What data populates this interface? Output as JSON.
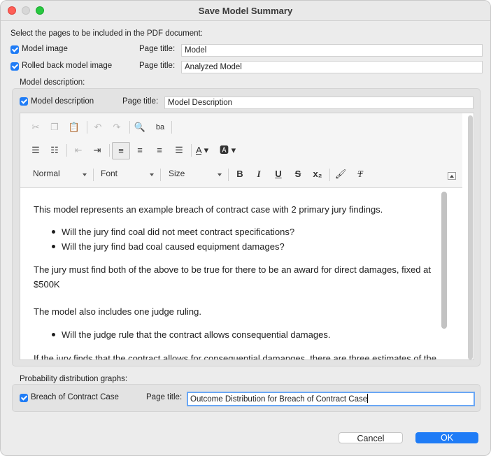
{
  "window": {
    "title": "Save Model Summary"
  },
  "intro_text": "Select the pages to be included in the PDF document:",
  "page_title_label": "Page title:",
  "pages": [
    {
      "checkbox_label": "Model image",
      "checked": true,
      "page_title": "Model"
    },
    {
      "checkbox_label": "Rolled back model image",
      "checked": true,
      "page_title": "Analyzed Model"
    }
  ],
  "model_description": {
    "section_label": "Model description:",
    "checkbox_label": "Model description",
    "checked": true,
    "page_title": "Model Description",
    "editor": {
      "toolbar": {
        "row1_icons": [
          "cut-icon",
          "copy-icon",
          "paste-icon",
          "undo-icon",
          "redo-icon",
          "find-icon",
          "replace-icon"
        ],
        "row2_icons": [
          "numbered-list-icon",
          "bulleted-list-icon",
          "decrease-indent-icon",
          "increase-indent-icon",
          "align-left-icon",
          "align-center-icon",
          "align-right-icon",
          "justify-icon",
          "text-color-icon",
          "background-color-icon"
        ],
        "format_select": "Normal",
        "font_select": "Font",
        "size_select": "Size",
        "bold": "B",
        "italic": "I",
        "underline": "U",
        "strikethrough": "S",
        "subscript": "x₂",
        "clear_format": "T"
      },
      "content": {
        "p1": "This model represents an example breach of contract case with 2 primary jury findings.",
        "list1": [
          "Will the jury find coal did not meet contract specifications?",
          "Will the jury find bad coal caused equipment damages?"
        ],
        "p2": "The jury must find both of the above to be true for there to be an award for direct damages, fixed at $500K",
        "p3": "The model also includes one judge ruling.",
        "list2": [
          "Will the judge rule that the contract allows consequential damages."
        ],
        "p4": "If the jury finds that the contract allows for consequential damanges, there are three estimates of the"
      }
    }
  },
  "probability": {
    "section_label": "Probability distribution graphs:",
    "checkbox_label": "Breach of Contract Case",
    "checked": true,
    "page_title": "Outcome Distribution for Breach of Contract Case"
  },
  "buttons": {
    "cancel": "Cancel",
    "ok": "OK"
  },
  "colors": {
    "accent": "#1f7cf6",
    "window_bg": "#ececec",
    "group_bg": "#e3e3e3"
  }
}
